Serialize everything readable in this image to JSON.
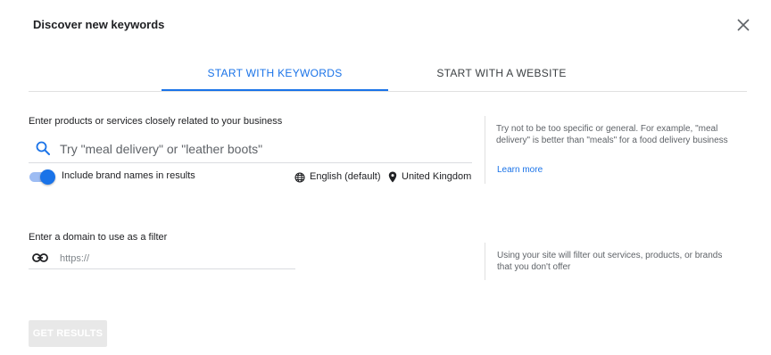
{
  "dialog": {
    "title": "Discover new keywords",
    "close_icon": "close-icon"
  },
  "tabs": [
    {
      "label": "START WITH KEYWORDS",
      "active": true
    },
    {
      "label": "START WITH A WEBSITE",
      "active": false
    }
  ],
  "keywords": {
    "label": "Enter products or services closely related to your business",
    "placeholder": "Try \"meal delivery\" or \"leather boots\"",
    "value": "",
    "brand_toggle": {
      "label": "Include brand names in results",
      "on": true
    },
    "language": {
      "icon": "globe-icon",
      "label": "English (default)"
    },
    "location": {
      "icon": "location-pin-icon",
      "label": "United Kingdom"
    },
    "help_text": "Try not to be too specific or general. For example, \"meal delivery\" is better than \"meals\" for a food delivery business",
    "learn_more": "Learn more"
  },
  "domain": {
    "label": "Enter a domain to use as a filter",
    "placeholder": "https://",
    "value": "",
    "help_text": "Using your site will filter out services, products, or brands that you don't offer"
  },
  "actions": {
    "get_results_label": "GET RESULTS",
    "get_results_enabled": false
  },
  "colors": {
    "accent": "#1a73e8",
    "text": "#202124",
    "muted": "#5f6368",
    "disabled_button": "#e8e8e8"
  }
}
